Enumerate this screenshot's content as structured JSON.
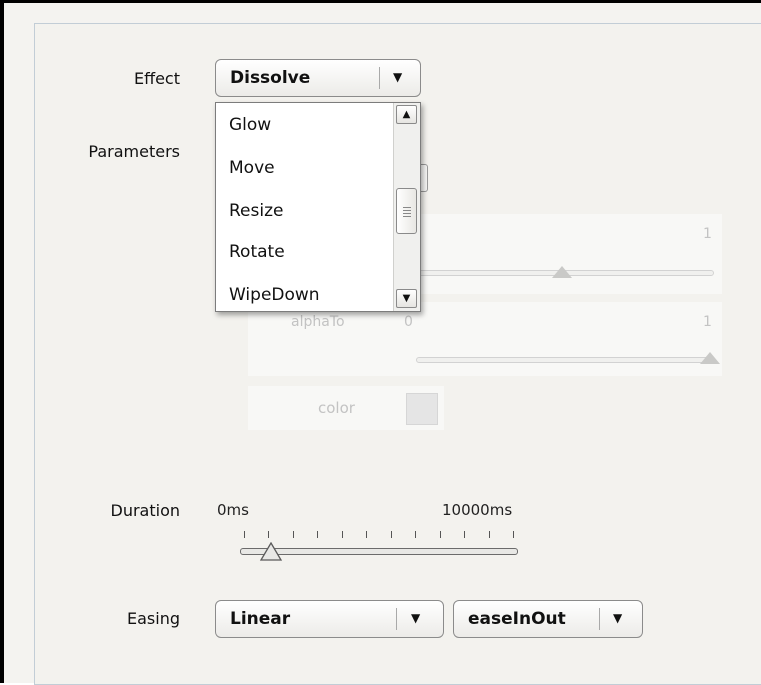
{
  "labels": {
    "effect": "Effect",
    "parameters": "Parameters",
    "duration": "Duration",
    "easing": "Easing"
  },
  "effect_combo": {
    "value": "Dissolve"
  },
  "effect_options": [
    "Glow",
    "Move",
    "Resize",
    "Rotate",
    "WipeDown"
  ],
  "params": {
    "alpha_from_max": "1",
    "alpha_from_value": 0.5,
    "alpha_to_label": "alphaTo",
    "alpha_to_min": "0",
    "alpha_to_max": "1",
    "alpha_to_value": 1.0,
    "color_label": "color"
  },
  "duration": {
    "min_label": "0ms",
    "max_label": "10000ms",
    "value_fraction": 0.1
  },
  "easing": {
    "type": "Linear",
    "mode": "easeInOut"
  },
  "colors": {
    "panel_bg": "#f3f2ee",
    "frame_border": "#000000",
    "faded_text": "#c3c3c3"
  }
}
